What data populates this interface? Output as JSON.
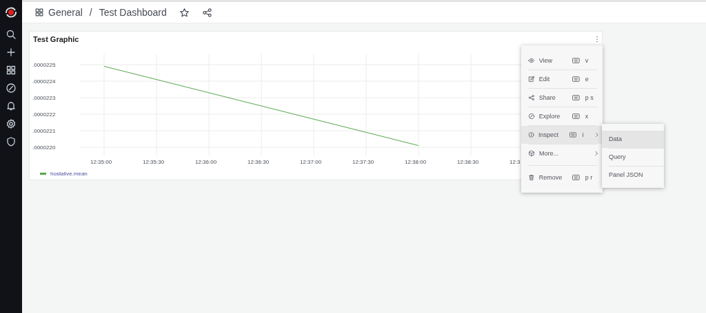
{
  "breadcrumb": {
    "folder": "General",
    "separator": "/",
    "dashboard": "Test Dashboard"
  },
  "panel": {
    "title": "Test Graphic",
    "chart_data": {
      "type": "line",
      "categories": [
        "12:35:00",
        "12:35:30",
        "12:36:00",
        "12:36:30",
        "12:37:00",
        "12:37:30",
        "12:38:00",
        "12:38:30",
        "12:3"
      ],
      "series": [
        {
          "name": "hostalive.mean",
          "color": "#56a64b",
          "values": [
            2.249e-05,
            2.241e-05,
            2.233e-05,
            2.225e-05,
            2.217e-05,
            2.209e-05,
            2.201e-05,
            null,
            null
          ]
        }
      ],
      "grid": true,
      "ylim": [
        2.2e-05,
        2.25e-05
      ],
      "yticks": [
        {
          "value": 2.25e-05,
          "label": ".0000225"
        },
        {
          "value": 2.24e-05,
          "label": ".0000224"
        },
        {
          "value": 2.23e-05,
          "label": ".0000223"
        },
        {
          "value": 2.22e-05,
          "label": ".0000222"
        },
        {
          "value": 2.21e-05,
          "label": ".0000221"
        },
        {
          "value": 2.2e-05,
          "label": ".0000220"
        }
      ]
    }
  },
  "menu": [
    {
      "label": "View",
      "shortcut": "v",
      "selected": false,
      "submenu": false
    },
    {
      "label": "Edit",
      "shortcut": "e",
      "selected": false,
      "submenu": false
    },
    {
      "label": "Share",
      "shortcut": "p s",
      "selected": false,
      "submenu": false
    },
    {
      "label": "Explore",
      "shortcut": "x",
      "selected": false,
      "submenu": false
    },
    {
      "label": "Inspect",
      "shortcut": "i",
      "selected": true,
      "submenu": true
    },
    {
      "label": "More...",
      "selected": false,
      "submenu": true
    },
    {
      "label": "Remove",
      "shortcut": "p r",
      "selected": false,
      "submenu": false
    }
  ],
  "submenu": [
    {
      "label": "Data",
      "selected": true
    },
    {
      "label": "Query",
      "selected": false
    },
    {
      "label": "Panel JSON",
      "selected": false
    }
  ]
}
